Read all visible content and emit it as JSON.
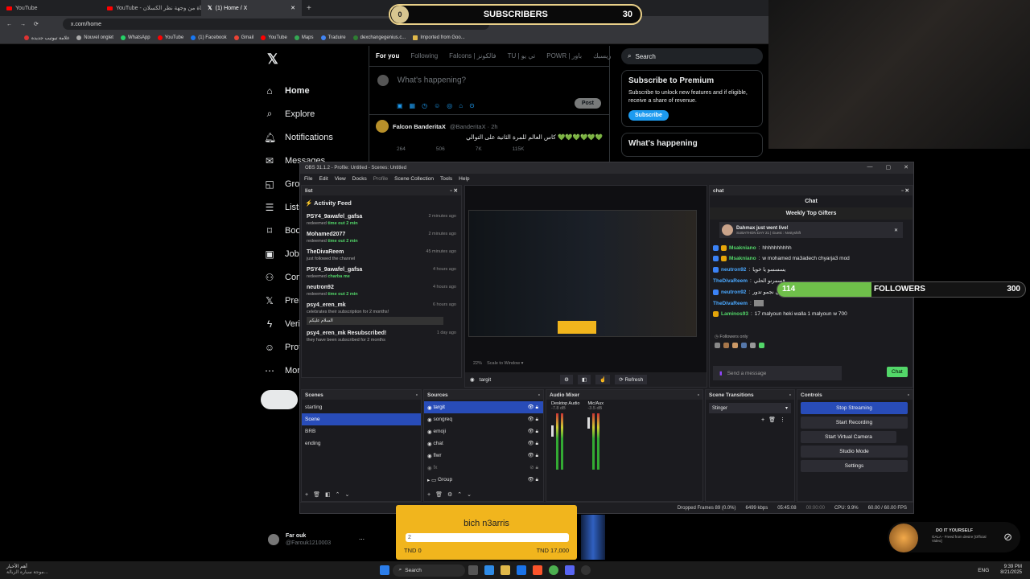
{
  "browser": {
    "tabs": [
      "YouTube",
      "YouTube - الحياة من وجهة نظر الكسلان",
      "(1) Home / X"
    ],
    "url": "x.com/home",
    "bookmarks": [
      "غلامة تيوتيب جديدة",
      "Nouvel onglet",
      "WhatsApp",
      "YouTube",
      "(1) Facebook",
      "Gmail",
      "YouTube",
      "Maps",
      "Traduire",
      "dexchangegenius.c...",
      "Imported from Goo..."
    ]
  },
  "x": {
    "nav": [
      "Home",
      "Explore",
      "Notifications",
      "Messages",
      "Grok",
      "Lists",
      "Bookmarks",
      "Jobs",
      "Communities",
      "Premium",
      "Verified Orgs",
      "Profile",
      "More"
    ],
    "feed_tabs": [
      "For you",
      "Following",
      "Falcons | فالكونز",
      "TU | تي يو",
      "POWR | باور",
      "ريسبك"
    ],
    "compose_placeholder": "What's happening?",
    "post_label": "Post",
    "tweet": {
      "author": "Falcon BanderitaX",
      "handle": "@BanderitaX · 2h",
      "text": "كاس العالم للمرة الثانية على التوالي 💚💚💚💚💚💚",
      "stats": [
        "264",
        "506",
        "7K",
        "115K"
      ]
    },
    "search_placeholder": "Search",
    "premium": {
      "title": "Subscribe to Premium",
      "text": "Subscribe to unlock new features and if eligible, receive a share of revenue.",
      "button": "Subscribe"
    },
    "happening": "What's happening",
    "user": {
      "name": "Far ouk",
      "handle": "@Farouk1210003"
    }
  },
  "overlays": {
    "subscribers": {
      "label": "SUBSCRIBERS",
      "current": "0",
      "goal": "30"
    },
    "followers": {
      "label": "FOLLOWERS",
      "current": "114",
      "goal": "300",
      "progress": 0.38
    }
  },
  "obs": {
    "title": "OBS 31.1.2 - Profile: Untitled - Scenes: Untitled",
    "menu": [
      "File",
      "Edit",
      "View",
      "Docks",
      "Profile",
      "Scene Collection",
      "Tools",
      "Help"
    ],
    "list_dock": "list",
    "activity_title": "Activity Feed",
    "activity": [
      {
        "name": "PSY4_9awafel_gafsa",
        "action": "redeemed",
        "highlight": "time out 2 min",
        "time": "2 minutes ago"
      },
      {
        "name": "Mohamed2077",
        "action": "redeemed",
        "highlight": "time out 2 min",
        "time": "2 minutes ago"
      },
      {
        "name": "TheDivaReem",
        "action": "just followed the channel",
        "highlight": "",
        "time": "45 minutes ago"
      },
      {
        "name": "PSY4_9awafel_gafsa",
        "action": "redeemed",
        "highlight": "charba me",
        "time": "4 hours ago"
      },
      {
        "name": "neutron92",
        "action": "redeemed",
        "highlight": "time out 2 min",
        "time": "4 hours ago"
      },
      {
        "name": "psy4_eren_mk",
        "action": "celebrates their subscription for 2 months!",
        "highlight": "",
        "time": "6 hours ago",
        "message": "السلام عليكم"
      },
      {
        "name": "psy4_eren_mk Resubscribed!",
        "action": "they have been subscribed for 2 months",
        "highlight": "",
        "time": "1 day ago"
      }
    ],
    "preview": {
      "zoom": "22%",
      "scale": "Scale to Window",
      "source": "targit",
      "refresh": "Refresh"
    },
    "chat": {
      "dock": "chat",
      "title": "Chat",
      "gifters": "Weekly Top Gifters",
      "banner": {
        "name": "Dahmax just went live!",
        "sub": "SUBATHON DAY 21 | Guest : Nvstyshift"
      },
      "lines": [
        {
          "name": "Msakniano",
          "text": "hhhhhhhhhh",
          "color": "#53d769"
        },
        {
          "name": "Msakniano",
          "text": "w mohamed ma3adech chyarja3 mod",
          "color": "#53d769"
        },
        {
          "name": "neutron92",
          "text": "يسسسو يا خويا",
          "color": "#4aa8ff"
        },
        {
          "name": "TheDivaReem",
          "text": "قسمرنو الحلي",
          "color": "#4aa8ff"
        },
        {
          "name": "neutron92",
          "text": "ماو بلشي نجمو تدور",
          "color": "#4aa8ff"
        },
        {
          "name": "TheDivaReem",
          "text": "",
          "color": "#4aa8ff"
        },
        {
          "name": "Laminos93",
          "text": "17 malyoun heki walla 1 malyoun w 700",
          "color": "#53d769"
        }
      ],
      "followers_only": "Followers only",
      "placeholder": "Send a message",
      "send": "Chat"
    },
    "scenes": {
      "title": "Scenes",
      "items": [
        "starting",
        "Scene",
        "BRB",
        "ending"
      ],
      "selected": 1
    },
    "sources": {
      "title": "Sources",
      "items": [
        "targit",
        "songreq",
        "emoji",
        "chat",
        "flwr",
        "fx",
        "Group"
      ]
    },
    "mixer": {
      "title": "Audio Mixer",
      "channels": [
        {
          "name": "Desktop Audio",
          "db": "-7.8 dB"
        },
        {
          "name": "Mic/Aux",
          "db": "-3.5 dB"
        }
      ]
    },
    "transitions": {
      "title": "Scene Transitions",
      "value": "Stinger"
    },
    "controls": {
      "title": "Controls",
      "buttons": [
        "Stop Streaming",
        "Start Recording",
        "Start Virtual Camera",
        "Studio Mode",
        "Settings"
      ]
    },
    "status": [
      "Dropped Frames 89 (0.0%)",
      "6499 kbps",
      "05:45:08",
      "00:00:00",
      "CPU: 9.9%",
      "60.00 / 60.00 FPS"
    ]
  },
  "donation": {
    "title": "bich n3arris",
    "current": "2",
    "min": "TND 0",
    "max": "TND 17,000"
  },
  "music": {
    "title": "DO IT YOURSELF",
    "sub": "GALA - Freed from desire [Official Video]"
  },
  "taskbar": {
    "news_title": "أهم الأخبار",
    "news_sub": "موجة سيارة الزبالة...",
    "search": "Search",
    "lang": "ENG",
    "time": "9:39 PM",
    "date": "8/21/2025"
  }
}
